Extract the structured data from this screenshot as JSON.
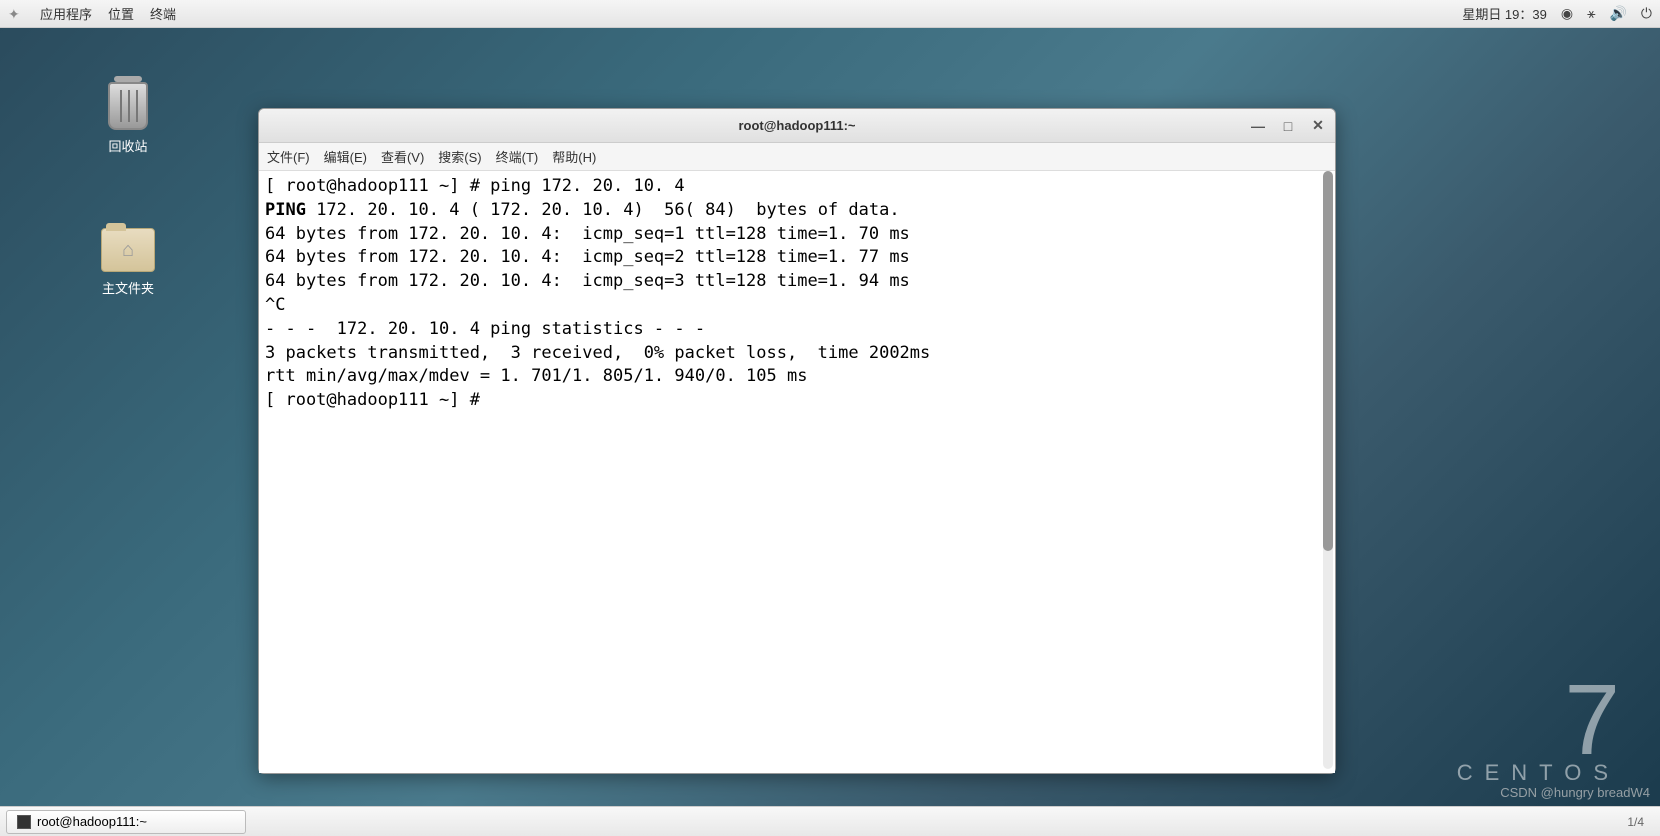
{
  "topbar": {
    "menu": {
      "applications": "应用程序",
      "places": "位置",
      "terminal": "终端"
    },
    "datetime": "星期日 19：39"
  },
  "desktop_icons": {
    "trash": "回收站",
    "home": "主文件夹"
  },
  "terminal": {
    "title": "root@hadoop111:~",
    "menus": {
      "file": "文件(F)",
      "edit": "编辑(E)",
      "view": "查看(V)",
      "search": "搜索(S)",
      "terminal": "终端(T)",
      "help": "帮助(H)"
    },
    "lines": {
      "prompt1": "[ root@hadoop111 ~] # ping 172. 20. 10. 4",
      "ping_header_bold": "PING",
      "ping_header_rest": " 172. 20. 10. 4 ( 172. 20. 10. 4)  56( 84)  bytes of data.",
      "reply1": "64 bytes from 172. 20. 10. 4:  icmp_seq=1 ttl=128 time=1. 70 ms",
      "reply2": "64 bytes from 172. 20. 10. 4:  icmp_seq=2 ttl=128 time=1. 77 ms",
      "reply3": "64 bytes from 172. 20. 10. 4:  icmp_seq=3 ttl=128 time=1. 94 ms",
      "interrupt": "^C",
      "stats_header": "- - -  172. 20. 10. 4 ping statistics - - -",
      "stats1": "3 packets transmitted,  3 received,  0% packet loss,  time 2002ms",
      "stats2": "rtt min/avg/max/mdev = 1. 701/1. 805/1. 940/0. 105 ms",
      "prompt2": "[ root@hadoop111 ~] # "
    }
  },
  "centos": {
    "version": "7",
    "name": "CENTOS"
  },
  "watermark": "CSDN @hungry breadW4",
  "taskbar": {
    "task1": "root@hadoop111:~",
    "pages": "1/4"
  }
}
